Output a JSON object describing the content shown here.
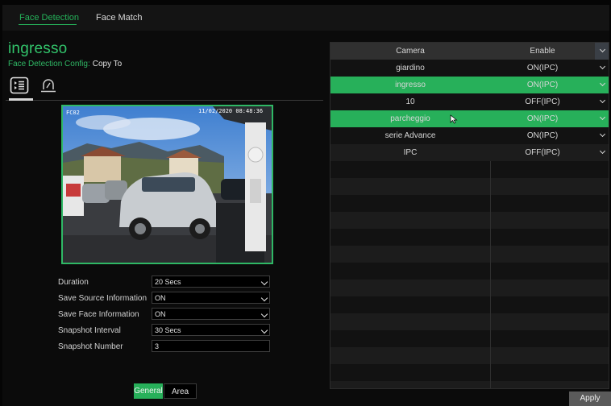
{
  "tabs": [
    {
      "label": "Face Detection",
      "active": true
    },
    {
      "label": "Face Match",
      "active": false
    }
  ],
  "camera_name": "ingresso",
  "config": {
    "label": "Face Detection Config:",
    "copy_to": "Copy To"
  },
  "icons": {
    "settings_tab": "list-icon",
    "schedule_tab": "alarm-light-icon"
  },
  "preview": {
    "osd_left": "FC02",
    "osd_right": "11/02/2020 08:48:36"
  },
  "form": [
    {
      "label": "Duration",
      "value": "20 Secs",
      "type": "select"
    },
    {
      "label": "Save Source Information",
      "value": "ON",
      "type": "select"
    },
    {
      "label": "Save Face Information",
      "value": "ON",
      "type": "select"
    },
    {
      "label": "Snapshot Interval",
      "value": "30 Secs",
      "type": "select"
    },
    {
      "label": "Snapshot Number",
      "value": "3",
      "type": "input"
    }
  ],
  "subtabs": [
    {
      "label": "General",
      "active": true
    },
    {
      "label": "Area",
      "active": false
    }
  ],
  "table": {
    "headers": [
      "Camera",
      "Enable"
    ],
    "rows": [
      {
        "camera": "giardino",
        "enable": "ON(IPC)",
        "highlighted": false
      },
      {
        "camera": "ingresso",
        "enable": "ON(IPC)",
        "highlighted": true
      },
      {
        "camera": "10",
        "enable": "OFF(IPC)",
        "highlighted": false
      },
      {
        "camera": "parcheggio",
        "enable": "ON(IPC)",
        "highlighted": true
      },
      {
        "camera": "serie Advance",
        "enable": "ON(IPC)",
        "highlighted": false
      },
      {
        "camera": "IPC",
        "enable": "OFF(IPC)",
        "highlighted": false
      }
    ]
  },
  "apply_label": "Apply",
  "colors": {
    "accent": "#2fb865",
    "highlight": "#27b05a",
    "background": "#0b0b0b"
  }
}
